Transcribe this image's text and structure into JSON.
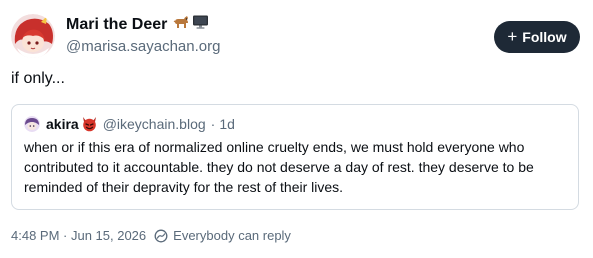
{
  "author": {
    "display_name": "Mari the Deer",
    "name_emojis": [
      "dog-emoji",
      "computer-emoji"
    ],
    "handle": "@marisa.sayachan.org",
    "avatar": "red-hair-girl-avatar"
  },
  "follow_button": {
    "icon": "plus-icon",
    "label": "Follow"
  },
  "post": {
    "text": "if only..."
  },
  "quote": {
    "avatar": "purple-avatar",
    "display_name": "akira",
    "name_emoji": "devil-emoji",
    "handle": "@ikeychain.blog",
    "separator": "·",
    "time": "1d",
    "body": "when or if this era of normalized online cruelty ends, we must hold everyone who contributed to it accountable. they do not deserve a day of rest. they deserve to be reminded of their depravity for the rest of their lives."
  },
  "meta": {
    "timestamp": "4:48 PM · Jun 15, 2026",
    "reply_icon": "reply-restriction-icon",
    "reply_setting": "Everybody can reply"
  },
  "colors": {
    "follow_bg": "#1e2936",
    "muted_text": "#5a6a7a",
    "border": "#d4dbe2"
  }
}
